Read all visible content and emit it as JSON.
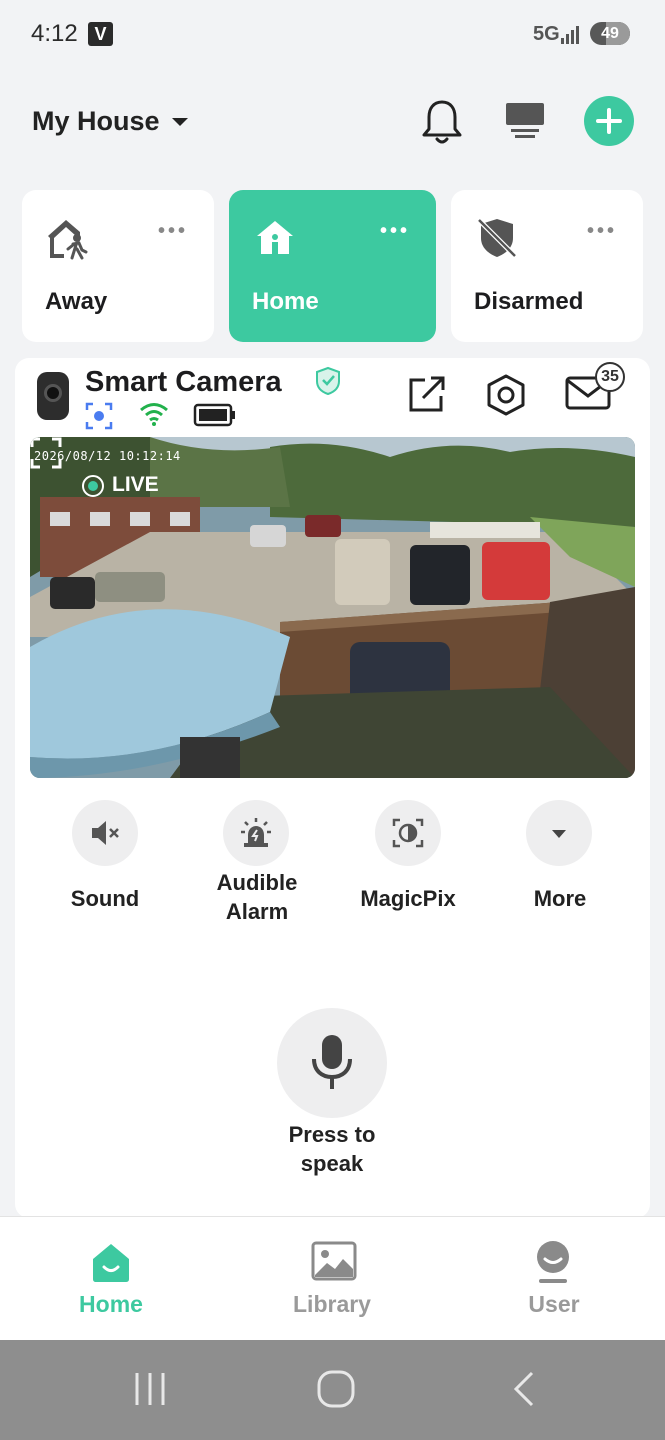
{
  "status_bar": {
    "time": "4:12",
    "app_glyph": "V",
    "network": "5G",
    "battery": "49"
  },
  "header": {
    "title": "My House"
  },
  "modes": [
    {
      "label": "Away",
      "icon": "away-person-house-icon",
      "active": false
    },
    {
      "label": "Home",
      "icon": "home-icon",
      "active": true
    },
    {
      "label": "Disarmed",
      "icon": "disarmed-shield-icon",
      "active": false
    }
  ],
  "camera": {
    "name": "Smart Camera",
    "timestamp": "2026/08/12 10:12:14",
    "live_label": "LIVE",
    "message_count": "35"
  },
  "controls": [
    {
      "label": "Sound",
      "icon": "sound-muted-icon"
    },
    {
      "label": "Audible\nAlarm",
      "icon": "alarm-siren-icon"
    },
    {
      "label": "MagicPix",
      "icon": "magicpix-icon"
    },
    {
      "label": "More",
      "icon": "chevron-down-icon"
    }
  ],
  "talk": {
    "label": "Press to\nspeak"
  },
  "bottom_nav": [
    {
      "label": "Home",
      "active": true
    },
    {
      "label": "Library",
      "active": false
    },
    {
      "label": "User",
      "active": false
    }
  ],
  "colors": {
    "accent": "#3dc9a0",
    "background": "#f2f3f5"
  }
}
